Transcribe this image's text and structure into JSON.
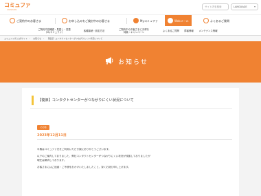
{
  "header": {
    "logo_main": "コミュファ",
    "logo_sub": "commufa",
    "search_placeholder": "サイト内を検索",
    "language": "LANGUAGE"
  },
  "mainnav": {
    "items": [
      {
        "label": "ご契約中のお客さま"
      },
      {
        "label": "お申し込みをご検討中のお客さま"
      },
      {
        "label": "Myコミュファ"
      },
      {
        "label": "Webメール"
      },
      {
        "label": "よくあるご質問"
      }
    ]
  },
  "subnav": {
    "items": [
      {
        "line1": "ご契約内容確認・見直し・変更",
        "line2": "（Myコミュファ）"
      },
      {
        "line1": "各種接続・設定方法",
        "line2": ""
      },
      {
        "line1": "ご契約中のお客さまにお得な",
        "line2": "特典・キャンペーン"
      },
      {
        "line1": "よくあるご質問",
        "line2": ""
      },
      {
        "line1": "障害情報",
        "line2": ""
      },
      {
        "line1": "メンテナンス情報",
        "line2": ""
      }
    ]
  },
  "breadcrumb": {
    "items": [
      "コミュファ光 公式サイト",
      "お知らせ",
      "【復旧】コンタクトセンターがつながりにくい状況について"
    ]
  },
  "hero": {
    "title": "お知らせ",
    "icon": "megaphone-icon"
  },
  "post": {
    "title": "【復旧】コンタクトセンターがつながりにくい状況について",
    "badge": "その他",
    "date": "2023年12月11日",
    "paragraphs": [
      "平素はコミュファ光をご利用いただき誠にありがとうございます。",
      "以下のご案内しておりました、弊社コンタクトセンターがつながりにくい状況が改善しておりましたが",
      "現在は解消しております。",
      "お客さまにはご迷惑・ご不便をおかけいたしましたこと、深くお詫び申し上げます。"
    ]
  },
  "colors": {
    "accent": "#f08232",
    "title_bar": "#f4c43a",
    "content_bg": "#f3f3f3"
  }
}
